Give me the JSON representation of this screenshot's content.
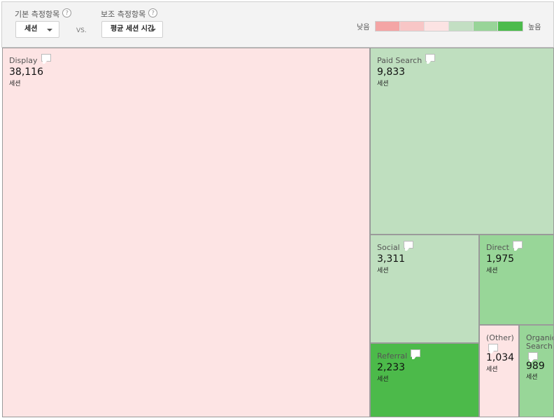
{
  "header": {
    "primary_metric_label": "기본 측정항목",
    "primary_metric_value": "세션",
    "vs_label": "VS.",
    "secondary_metric_label": "보조 측정항목",
    "secondary_metric_value": "평균 세션 시간",
    "help_glyph": "?"
  },
  "legend": {
    "low_label": "낮음",
    "high_label": "높음",
    "colors": [
      "#f4a5a5",
      "#f8c6c6",
      "#fce3e3",
      "#c3dfc3",
      "#98d498",
      "#4cbb4c"
    ]
  },
  "cells": [
    {
      "name": "Display",
      "value": "38,116",
      "unit": "세션",
      "color": "#fde4e4"
    },
    {
      "name": "Paid Search",
      "value": "9,833",
      "unit": "세션",
      "color": "#bfdfbf"
    },
    {
      "name": "Social",
      "value": "3,311",
      "unit": "세션",
      "color": "#bfdfbf"
    },
    {
      "name": "Direct",
      "value": "1,975",
      "unit": "세션",
      "color": "#98d698"
    },
    {
      "name": "Referral",
      "value": "2,233",
      "unit": "세션",
      "color": "#4cba4a"
    },
    {
      "name": "(Other)",
      "value": "1,034",
      "unit": "세션",
      "color": "#fde4e4"
    },
    {
      "name": "Organic Search",
      "value": "989",
      "unit": "세션",
      "color": "#98d698"
    }
  ]
}
